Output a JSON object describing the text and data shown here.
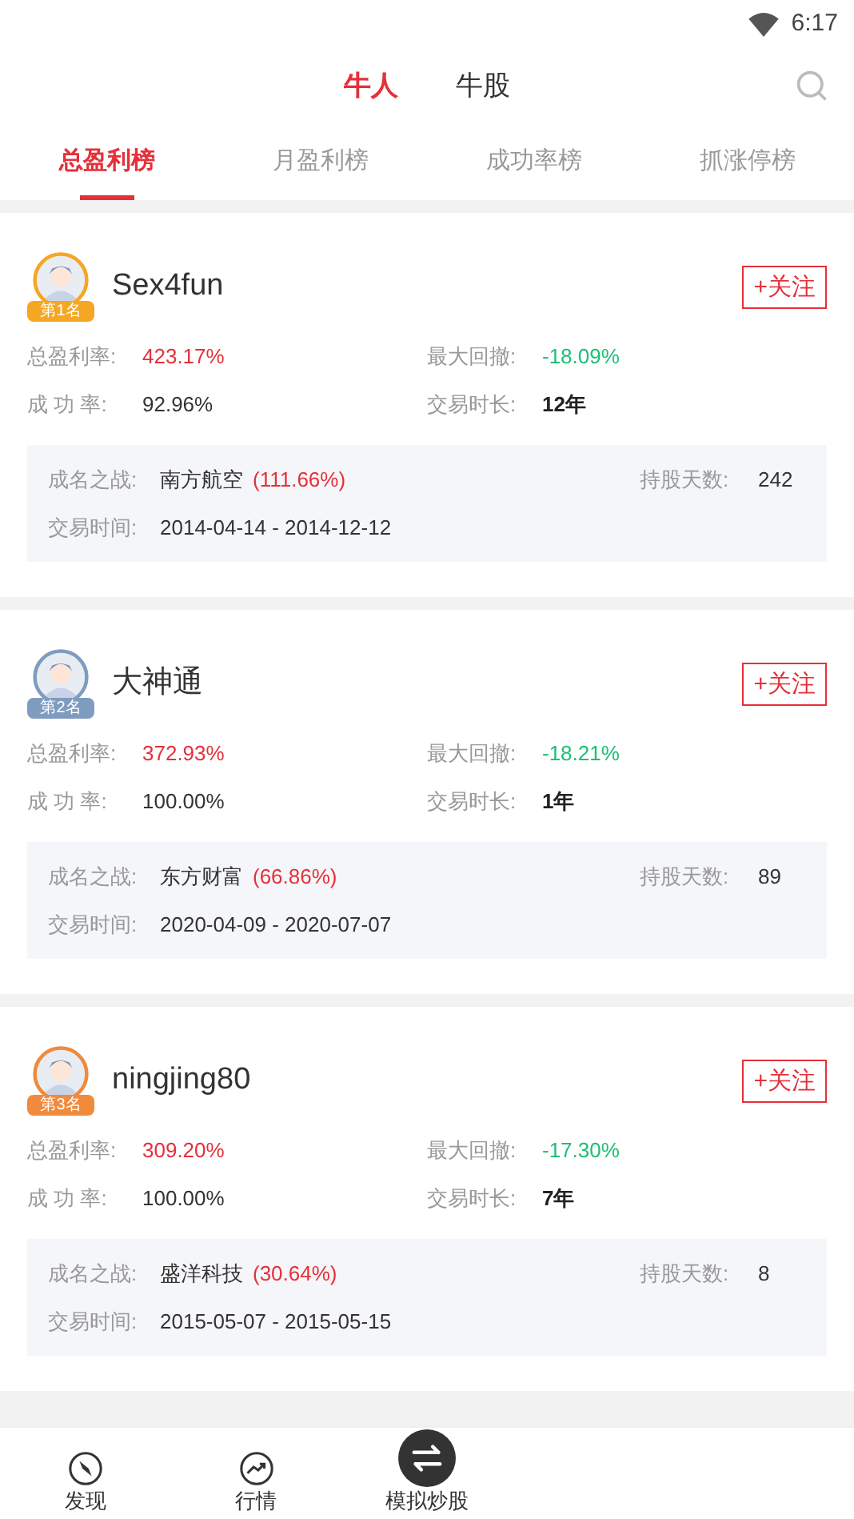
{
  "status_bar": {
    "time": "6:17"
  },
  "header": {
    "tabs": [
      {
        "label": "牛人",
        "selected": true
      },
      {
        "label": "牛股",
        "selected": false
      }
    ]
  },
  "ranking_tabs": [
    {
      "label": "总盈利榜",
      "selected": true
    },
    {
      "label": "月盈利榜",
      "selected": false
    },
    {
      "label": "成功率榜",
      "selected": false
    },
    {
      "label": "抓涨停榜",
      "selected": false
    }
  ],
  "traders": [
    {
      "name": "Sex4fun",
      "rank": "第1名",
      "color": "#f5a623",
      "follow": "+关注",
      "stats": [
        {
          "label": "总盈利率:",
          "value": "423.17%",
          "kind": "gain"
        },
        {
          "label": "最大回撤:",
          "value": "-18.09%",
          "kind": "loss"
        },
        {
          "label": "成 功 率:",
          "value": "92.96%",
          "kind": "plain"
        },
        {
          "label": "交易时长:",
          "value": "12年",
          "kind": "bold"
        }
      ],
      "famous_label": "成名之战:",
      "famous_stock": "南方航空",
      "famous_return": "(111.66%)",
      "days_label": "持股天数:",
      "days": "242",
      "period_label": "交易时间:",
      "period": "2014-04-14 - 2014-12-12"
    },
    {
      "name": "大神通",
      "rank": "第2名",
      "color": "#7f9cc0",
      "follow": "+关注",
      "stats": [
        {
          "label": "总盈利率:",
          "value": "372.93%",
          "kind": "gain"
        },
        {
          "label": "最大回撤:",
          "value": "-18.21%",
          "kind": "loss"
        },
        {
          "label": "成 功 率:",
          "value": "100.00%",
          "kind": "plain"
        },
        {
          "label": "交易时长:",
          "value": "1年",
          "kind": "bold"
        }
      ],
      "famous_label": "成名之战:",
      "famous_stock": "东方财富",
      "famous_return": "(66.86%)",
      "days_label": "持股天数:",
      "days": "89",
      "period_label": "交易时间:",
      "period": "2020-04-09 - 2020-07-07"
    },
    {
      "name": "ningjing80",
      "rank": "第3名",
      "color": "#f08a3c",
      "follow": "+关注",
      "stats": [
        {
          "label": "总盈利率:",
          "value": "309.20%",
          "kind": "gain"
        },
        {
          "label": "最大回撤:",
          "value": "-17.30%",
          "kind": "loss"
        },
        {
          "label": "成 功 率:",
          "value": "100.00%",
          "kind": "plain"
        },
        {
          "label": "交易时长:",
          "value": "7年",
          "kind": "bold"
        }
      ],
      "famous_label": "成名之战:",
      "famous_stock": "盛洋科技",
      "famous_return": "(30.64%)",
      "days_label": "持股天数:",
      "days": "8",
      "period_label": "交易时间:",
      "period": "2015-05-07 - 2015-05-15"
    }
  ],
  "bottom_nav": [
    {
      "label": "发现",
      "kind": "compass"
    },
    {
      "label": "行情",
      "kind": "trend"
    },
    {
      "label": "模拟炒股",
      "kind": "swap"
    }
  ]
}
